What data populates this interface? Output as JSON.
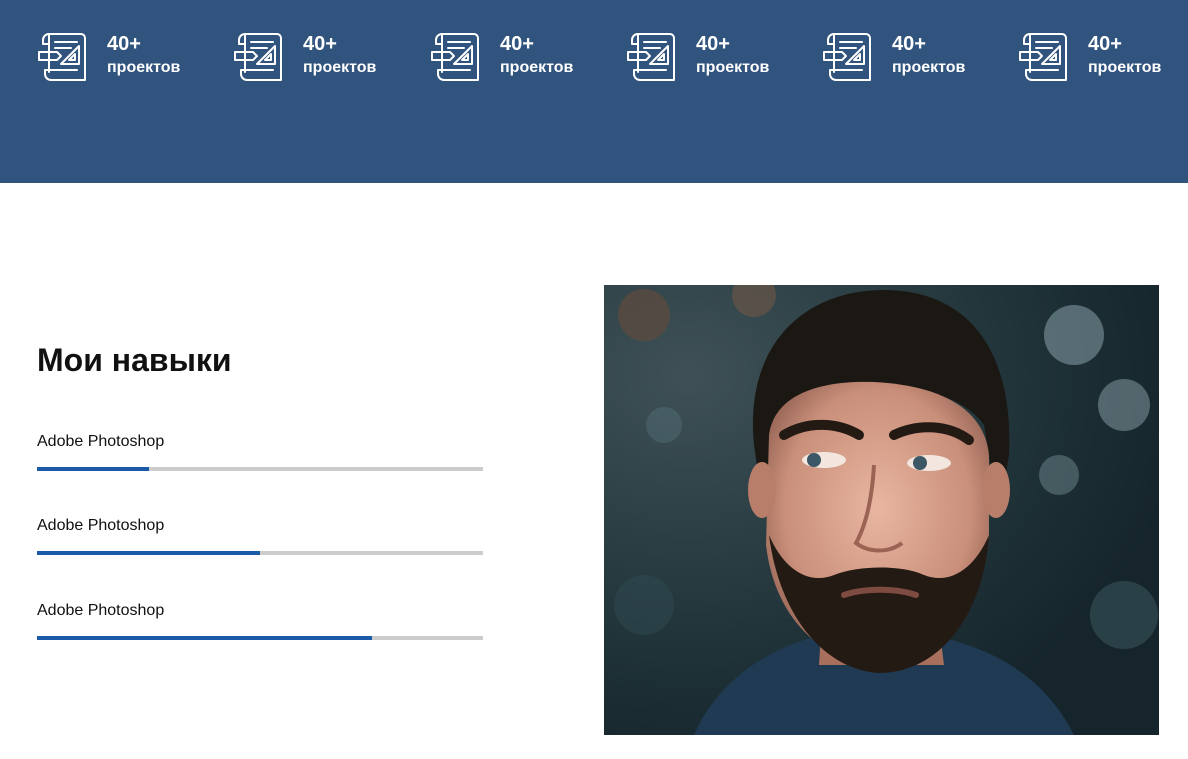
{
  "stats": [
    {
      "value": "40+",
      "label": "проектов",
      "icon": "blueprint-scroll-icon"
    },
    {
      "value": "40+",
      "label": "проектов",
      "icon": "blueprint-scroll-icon"
    },
    {
      "value": "40+",
      "label": "проектов",
      "icon": "blueprint-scroll-icon"
    },
    {
      "value": "40+",
      "label": "проектов",
      "icon": "blueprint-scroll-icon"
    },
    {
      "value": "40+",
      "label": "проектов",
      "icon": "blueprint-scroll-icon"
    },
    {
      "value": "40+",
      "label": "проектов",
      "icon": "blueprint-scroll-icon"
    }
  ],
  "skills": {
    "title": "Мои навыки",
    "items": [
      {
        "label": "Adobe Photoshop",
        "level": 0.25
      },
      {
        "label": "Adobe Photoshop",
        "level": 0.5
      },
      {
        "label": "Adobe Photoshop",
        "level": 0.75
      }
    ]
  },
  "colors": {
    "band": "#31547e",
    "accent": "#1a5aa6",
    "track": "#cccccc"
  }
}
